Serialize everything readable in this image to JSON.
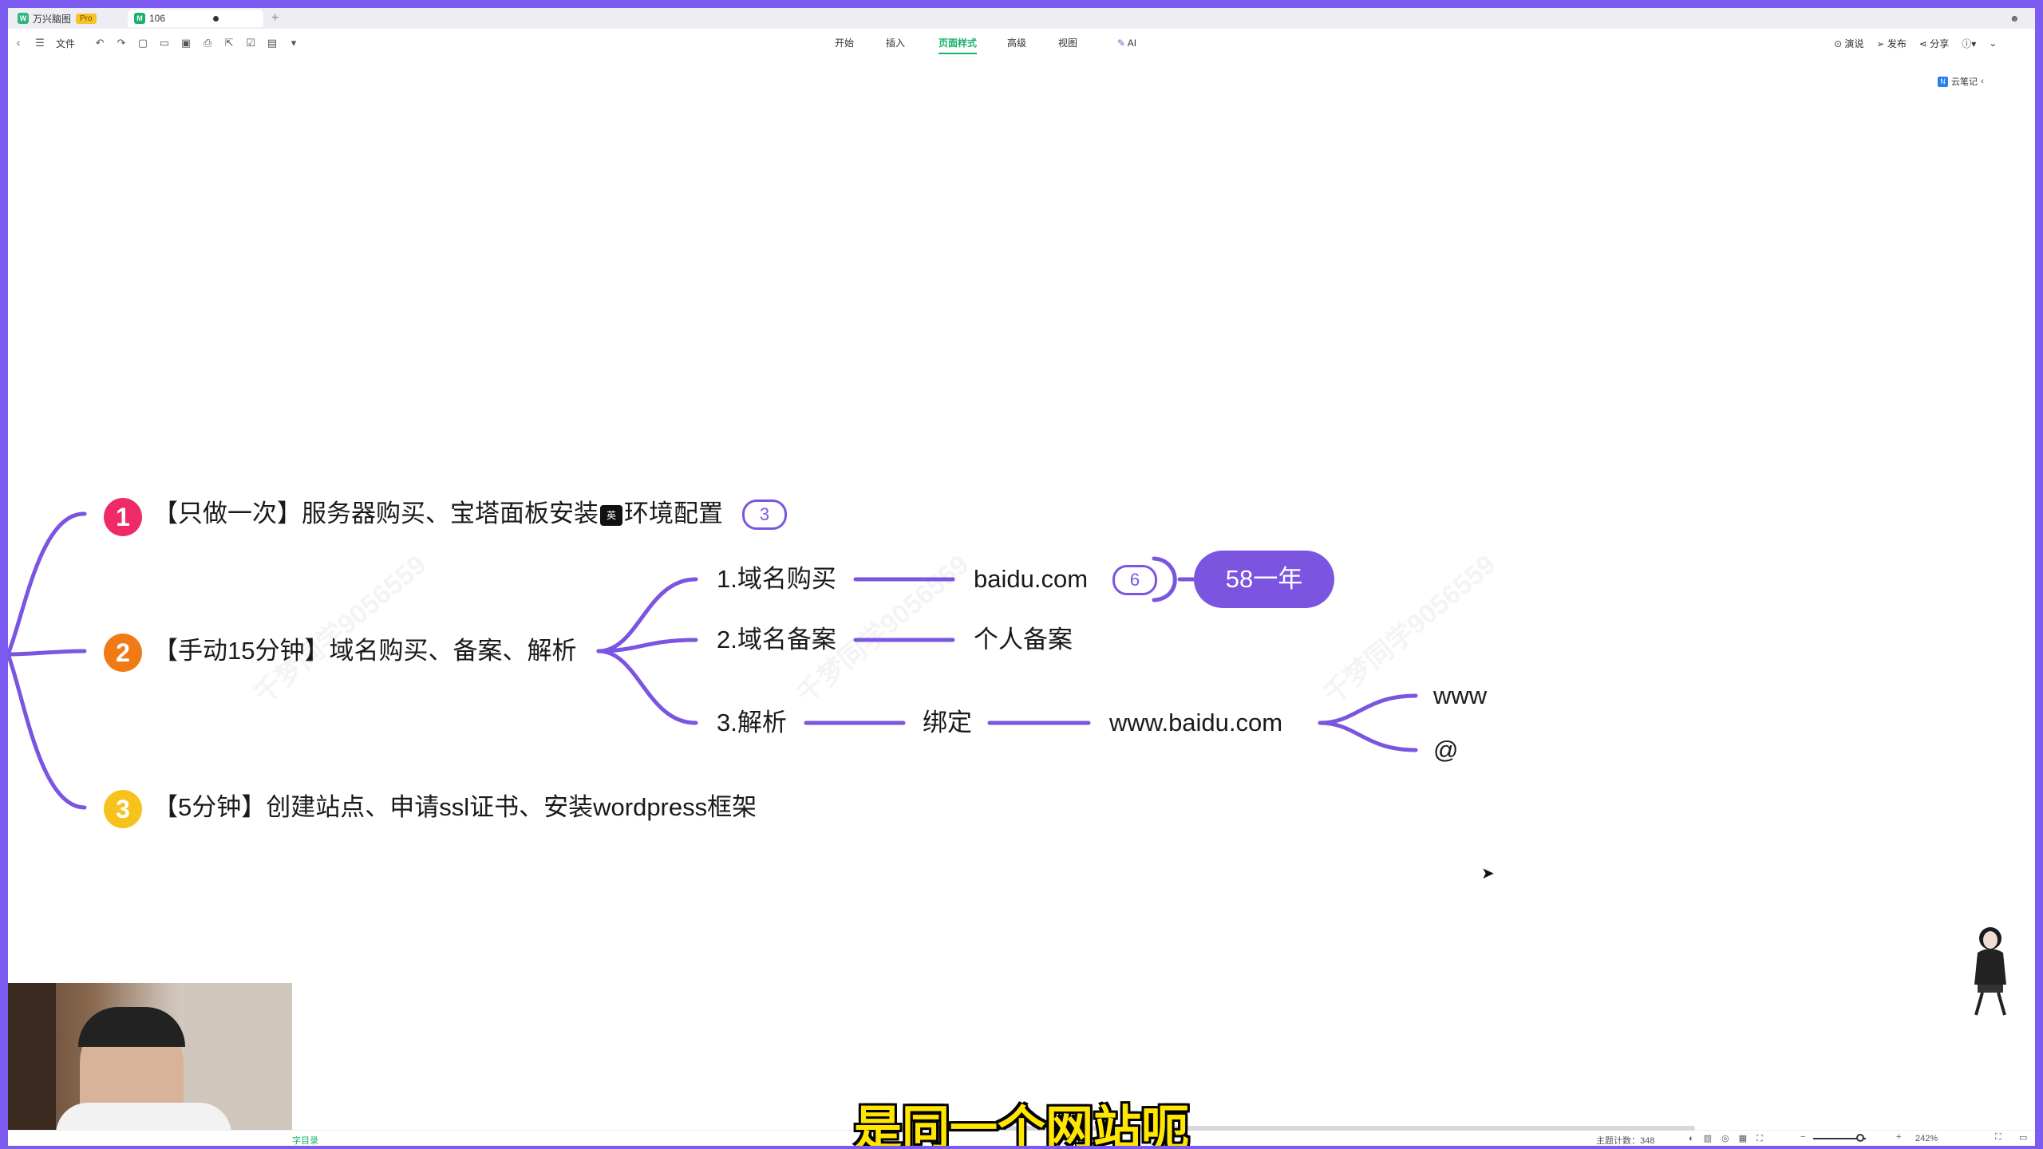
{
  "tabbar": {
    "app_name": "万兴脑图",
    "pro_badge": "Pro",
    "doc_tab": "106",
    "add_tab": "+"
  },
  "toolbar": {
    "file_label": "文件",
    "menus": [
      "开始",
      "插入",
      "页面样式",
      "高级",
      "视图",
      "AI"
    ],
    "active_menu": "页面样式",
    "right": {
      "present": "演说",
      "publish": "发布",
      "share": "分享"
    },
    "cloud_notes": "云笔记"
  },
  "mindmap": {
    "branches": [
      {
        "num": "1",
        "color": "#ee2b66",
        "text": "【只做一次】服务器购买、宝塔面板安装",
        "text_b": "环境配置",
        "count": "3"
      },
      {
        "num": "2",
        "color": "#f07a16",
        "text": "【手动15分钟】域名购买、备案、解析"
      },
      {
        "num": "3",
        "color": "#f6c21b",
        "text": "【5分钟】创建站点、申请ssl证书、安装wordpress框架"
      }
    ],
    "input_badge": "英",
    "sub": {
      "buy": "1.域名购买",
      "buy_value": "baidu.com",
      "buy_count": "6",
      "price": "58一年",
      "record": "2.域名备案",
      "record_value": "个人备案",
      "resolve": "3.解析",
      "bind": "绑定",
      "domain": "www.baidu.com",
      "hosts": [
        "www",
        "@"
      ]
    },
    "line_color": "#7b55e0"
  },
  "subtitle": "是同一个网站呃",
  "statusbar": {
    "left_link": "字目录",
    "topic_count_label": "主题计数：348",
    "zoom": "242%"
  }
}
